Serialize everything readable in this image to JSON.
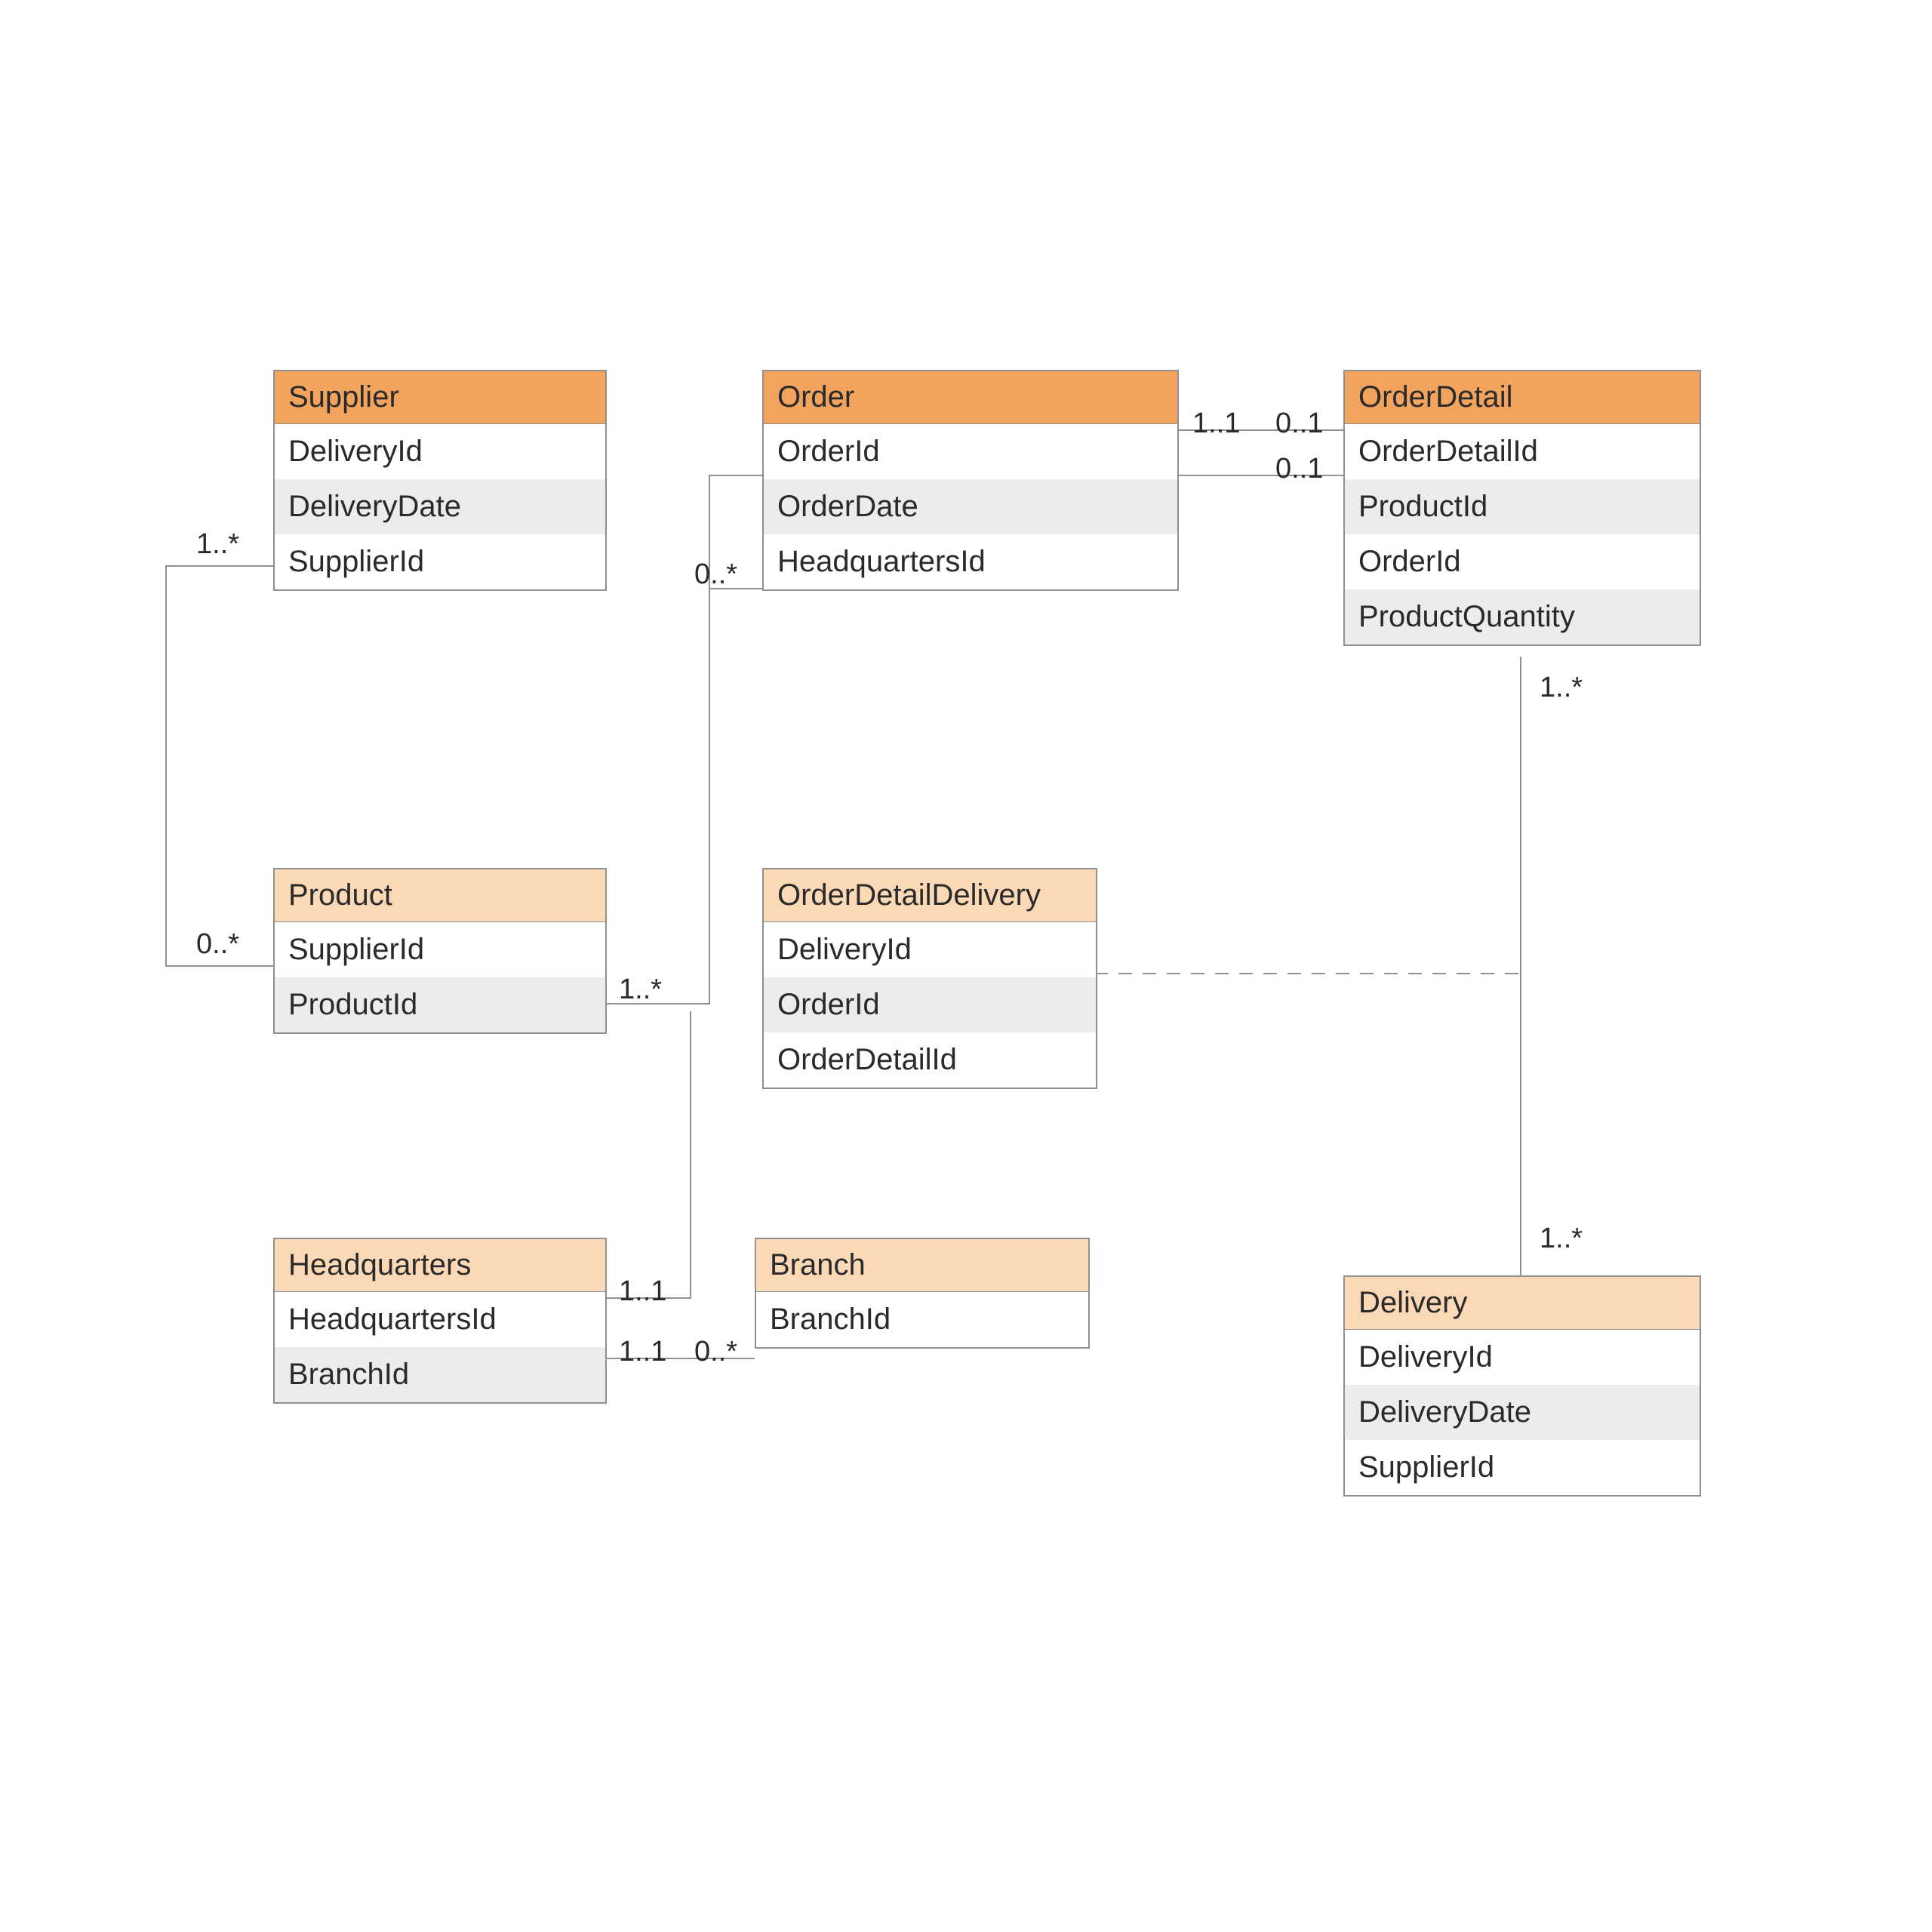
{
  "entities": {
    "supplier": {
      "title": "Supplier",
      "tone": "dark",
      "rows": [
        "DeliveryId",
        "DeliveryDate",
        "SupplierId"
      ]
    },
    "order": {
      "title": "Order",
      "tone": "dark",
      "rows": [
        "OrderId",
        "OrderDate",
        "HeadquartersId"
      ]
    },
    "orderDetail": {
      "title": "OrderDetail",
      "tone": "dark",
      "rows": [
        "OrderDetailId",
        "ProductId",
        "OrderId",
        "ProductQuantity"
      ]
    },
    "product": {
      "title": "Product",
      "tone": "light",
      "rows": [
        "SupplierId",
        "ProductId"
      ]
    },
    "orderDetailDelivery": {
      "title": "OrderDetailDelivery",
      "tone": "light",
      "rows": [
        "DeliveryId",
        "OrderId",
        "OrderDetailId"
      ]
    },
    "headquarters": {
      "title": "Headquarters",
      "tone": "light",
      "rows": [
        "HeadquartersId",
        "BranchId"
      ]
    },
    "branch": {
      "title": "Branch",
      "tone": "light",
      "rows": [
        "BranchId"
      ]
    },
    "delivery": {
      "title": "Delivery",
      "tone": "light",
      "rows": [
        "DeliveryId",
        "DeliveryDate",
        "SupplierId"
      ]
    }
  },
  "labels": {
    "supplier_product_top": "1..*",
    "supplier_product_bottom": "0..*",
    "order_od_left": "1..1",
    "order_od_right": "0..1",
    "product_od_left": "1..*",
    "product_od_right": "0..1",
    "order_hq": "0..*",
    "hq_branch_top": "1..1",
    "hq_branch_bottom": "1..1",
    "od_delivery_top": "1..*",
    "od_delivery_bottom": "1..*"
  }
}
